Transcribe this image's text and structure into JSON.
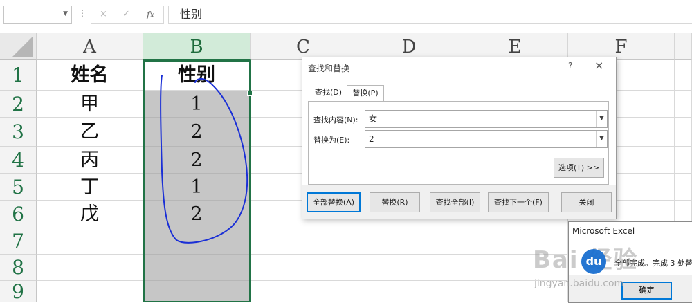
{
  "formula_bar": {
    "name_box_value": "",
    "cancel_icon": "×",
    "enter_icon": "✓",
    "fx_icon": "fx",
    "formula_value": "性别"
  },
  "sheet": {
    "columns": [
      "A",
      "B",
      "C",
      "D",
      "E",
      "F"
    ],
    "rows": [
      "1",
      "2",
      "3",
      "4",
      "5",
      "6",
      "7",
      "8",
      "9"
    ],
    "col_a": [
      "姓名",
      "甲",
      "乙",
      "丙",
      "丁",
      "戊",
      "",
      "",
      ""
    ],
    "col_b": [
      "性别",
      "1",
      "2",
      "2",
      "1",
      "2",
      "",
      "",
      ""
    ],
    "selected_column": "B",
    "accent_color": "#217346",
    "annotation_color": "#1a2fd6"
  },
  "find_replace": {
    "title": "查找和替换",
    "help": "?",
    "close": "×",
    "tab_find": "查找(D)",
    "tab_replace": "替换(P)",
    "find_label": "查找内容(N):",
    "find_value": "女",
    "replace_label": "替换为(E):",
    "replace_value": "2",
    "options_button": "选项(T) >>",
    "replace_all": "全部替换(A)",
    "replace": "替换(R)",
    "find_all": "查找全部(I)",
    "find_next": "查找下一个(F)",
    "close_button": "关闭"
  },
  "msgbox": {
    "title": "Microsoft Excel",
    "text": "全部完成。完成 3 处替",
    "ok": "确定"
  },
  "watermark": {
    "text": "Bai 经验",
    "logo": "du",
    "url": "jingyan.baidu.com"
  }
}
